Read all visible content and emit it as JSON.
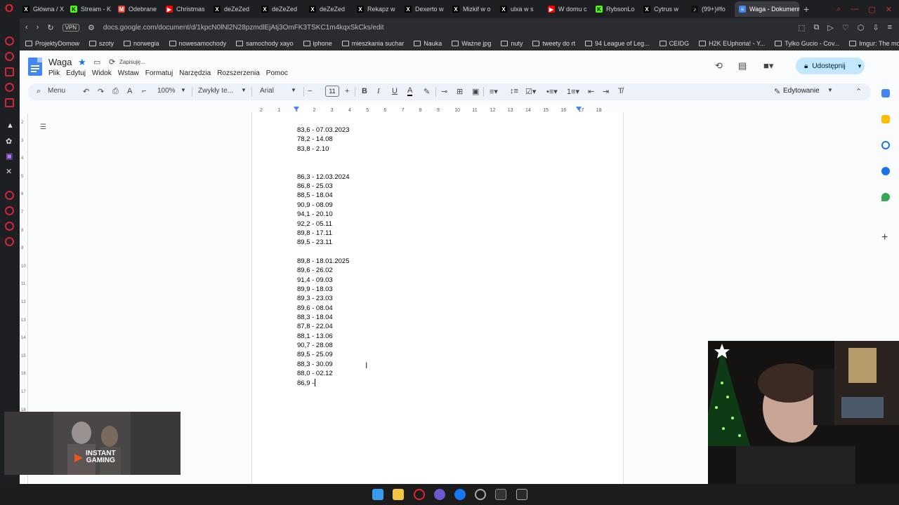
{
  "browser": {
    "tabs": [
      {
        "label": "Główna / X",
        "icon": "x-icon"
      },
      {
        "label": "Stream - K",
        "icon": "kick-icon"
      },
      {
        "label": "Odebrane",
        "icon": "gmail-icon"
      },
      {
        "label": "Christmas",
        "icon": "youtube-icon"
      },
      {
        "label": "deZeZed",
        "icon": "x-icon"
      },
      {
        "label": "deZeZed",
        "icon": "x-icon"
      },
      {
        "label": "deZeZed",
        "icon": "x-icon"
      },
      {
        "label": "Rekapz w",
        "icon": "x-icon"
      },
      {
        "label": "Dexerto w",
        "icon": "x-icon"
      },
      {
        "label": "Mizkif w o",
        "icon": "x-icon"
      },
      {
        "label": "ulxa w s",
        "icon": "x-icon"
      },
      {
        "label": "W domu c",
        "icon": "youtube-icon"
      },
      {
        "label": "RybsonLo",
        "icon": "kick-icon"
      },
      {
        "label": "Cytrus w",
        "icon": "x-icon"
      },
      {
        "label": "(99+)#fo",
        "icon": "tiktok-icon"
      }
    ],
    "active_tab": "Waga - Dokumenty",
    "url": "docs.google.com/document/d/1kpcN0lNl2N28pzmdlEjAtj3OmFK3TSKC1m4kqxSkCks/edit",
    "vpn_label": "VPN",
    "bookmarks": [
      "ProjektyDomow",
      "szoty",
      "norwegia",
      "nowesamochody",
      "samochody xayo",
      "iphone",
      "mieszkania suchar",
      "Nauka",
      "Ważne jpg",
      "nuty",
      "tweety do rt",
      "94 League of Leg...",
      "CEIDG",
      "H2K EUphoria! - Y...",
      "Tylko Gucio - Cov...",
      "Imgur: The most a..."
    ]
  },
  "docs": {
    "title": "Waga",
    "saving_status": "Zapisuję...",
    "menus": [
      "Plik",
      "Edytuj",
      "Widok",
      "Wstaw",
      "Formatuj",
      "Narzędzia",
      "Rozszerzenia",
      "Pomoc"
    ],
    "share_label": "Udostępnij",
    "toolbar": {
      "menu_label": "Menu",
      "zoom": "100%",
      "style": "Zwykły te...",
      "font": "Arial",
      "font_size": "11",
      "mode": "Edytowanie"
    },
    "ruler_numbers": [
      "2",
      "1",
      "1",
      "2",
      "3",
      "4",
      "5",
      "6",
      "7",
      "8",
      "9",
      "10",
      "11",
      "12",
      "13",
      "14",
      "15",
      "16",
      "17",
      "18"
    ],
    "vruler_numbers": [
      "2",
      "3",
      "4",
      "5",
      "6",
      "7",
      "8",
      "9",
      "10",
      "11",
      "12",
      "13",
      "14",
      "15",
      "16",
      "17",
      "18"
    ],
    "lines": [
      "83,6 - 07.03.2023",
      "78,2 - 14.08",
      "83,8 - 2.10",
      "",
      "",
      "86,3 - 12.03.2024",
      "86,8 - 25.03",
      "88,5 - 18.04",
      "90,9 - 08.09",
      "94,1 - 20.10",
      "92,2 - 05.11",
      "89,8 - 17.11",
      "89,5 - 23.11",
      "",
      "89,8 - 18.01.2025",
      "89,6 - 26.02",
      "91,4 - 09.03",
      "89,9 - 18.03",
      "89,3 - 23.03",
      "89,6 - 08.04",
      "88,3 - 18.04",
      "87,8 - 22.04",
      "88,1 - 13.06",
      "90,7 - 28.08",
      "89,5 - 25.09",
      "88,3 - 30.09",
      "88,0 - 02.12",
      "86,9 -"
    ]
  },
  "overlay": {
    "brand_line1": "INSTANT",
    "brand_line2": "GAMING"
  },
  "colors": {
    "docs_blue": "#4285f4",
    "share_bg": "#c2e7ff",
    "opera_red": "#e0242f",
    "active_tab": "#3a3b40"
  }
}
